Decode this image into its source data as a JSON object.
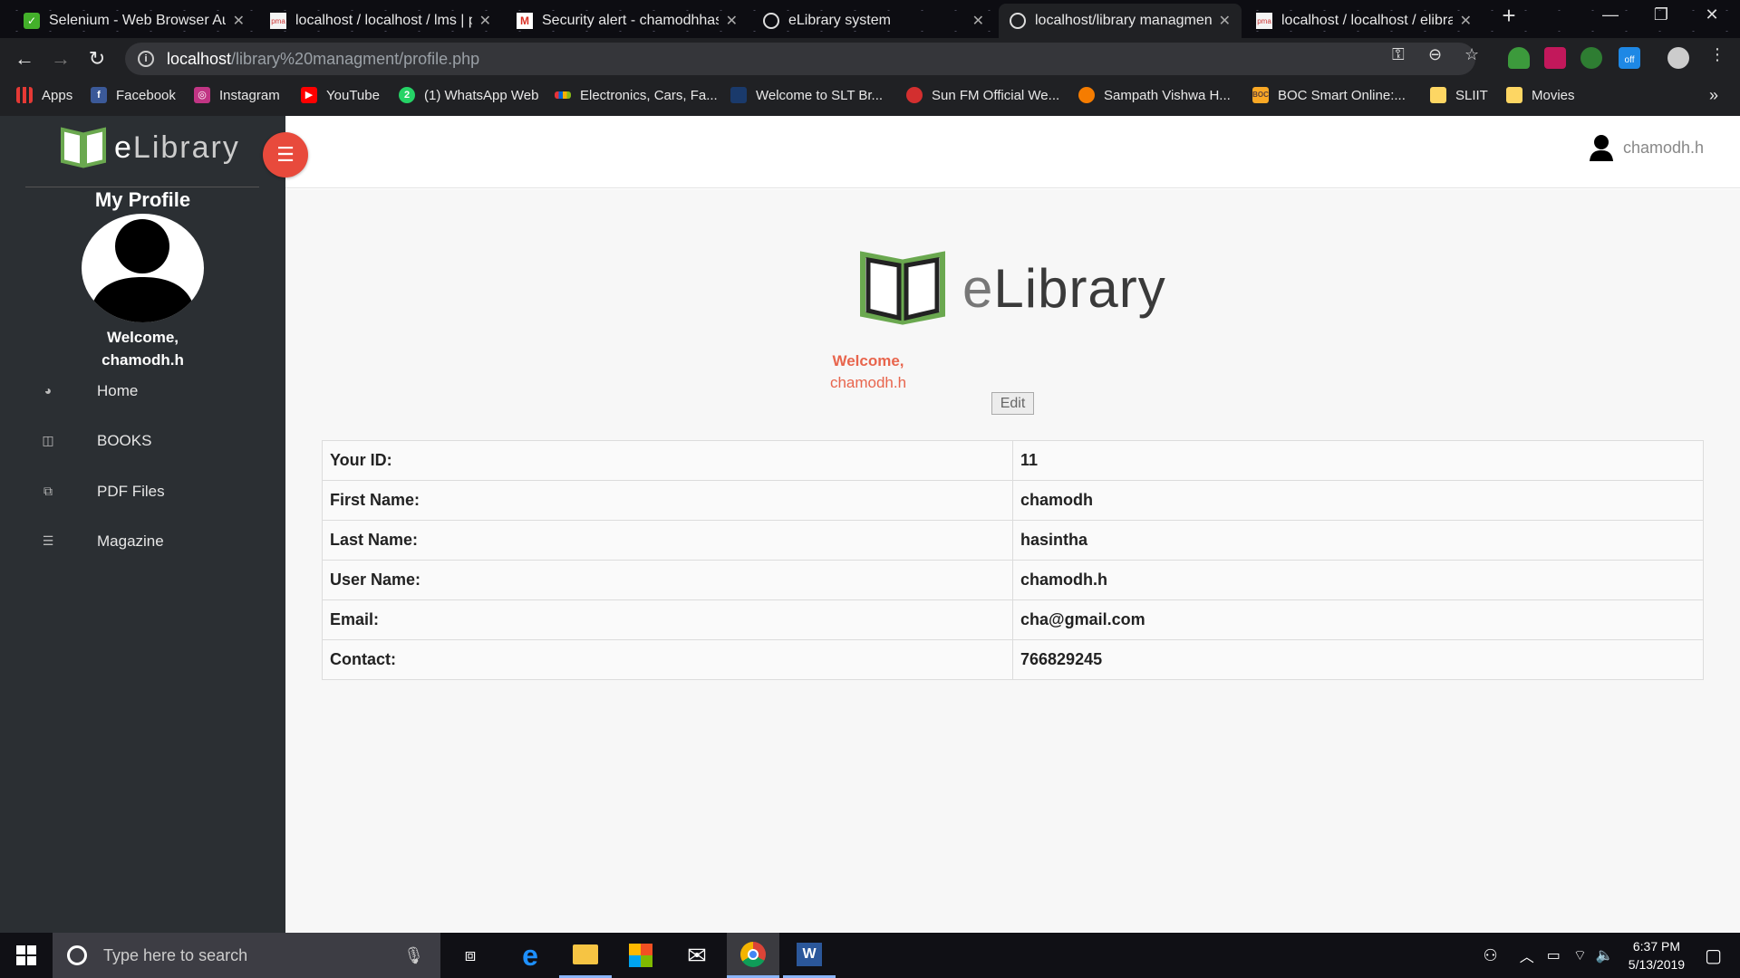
{
  "browser": {
    "tabs": [
      {
        "title": "Selenium - Web Browser Aut",
        "icon": "selenium-icon"
      },
      {
        "title": "localhost / localhost / lms | p",
        "icon": "phpmyadmin-icon"
      },
      {
        "title": "Security alert - chamodhhasi",
        "icon": "gmail-icon"
      },
      {
        "title": "eLibrary system",
        "icon": "globe-icon"
      },
      {
        "title": "localhost/library managment",
        "icon": "globe-icon"
      },
      {
        "title": "localhost / localhost / elibrar",
        "icon": "phpmyadmin-icon"
      }
    ],
    "url_host": "localhost",
    "url_path": "/library%20managment/profile.php",
    "bookmarks": [
      {
        "label": "Apps"
      },
      {
        "label": "Facebook"
      },
      {
        "label": "Instagram"
      },
      {
        "label": "YouTube"
      },
      {
        "label": "(1) WhatsApp Web"
      },
      {
        "label": "Electronics, Cars, Fa..."
      },
      {
        "label": "Welcome to SLT Br..."
      },
      {
        "label": "Sun FM Official We..."
      },
      {
        "label": "Sampath Vishwa H..."
      },
      {
        "label": "BOC Smart Online:..."
      },
      {
        "label": "SLIIT"
      },
      {
        "label": "Movies"
      }
    ],
    "more_bookmarks": "»",
    "extension_badge": "off"
  },
  "sidebar": {
    "logo_e": "e",
    "logo_rest": "Library",
    "title": "My Profile",
    "welcome_line1": "Welcome,",
    "welcome_line2": "chamodh.h",
    "items": [
      {
        "label": "Home",
        "icon": "dashboard-icon"
      },
      {
        "label": "BOOKS",
        "icon": "book-icon"
      },
      {
        "label": "PDF Files",
        "icon": "files-icon"
      },
      {
        "label": "Magazine",
        "icon": "magazine-icon"
      }
    ]
  },
  "header": {
    "username": "chamodh.h"
  },
  "main": {
    "logo_e": "e",
    "logo_rest": "Library",
    "welcome_line1": "Welcome,",
    "welcome_line2": "chamodh.h",
    "edit_label": "Edit",
    "rows": [
      {
        "key": "Your ID:",
        "value": "11"
      },
      {
        "key": "First Name:",
        "value": "chamodh"
      },
      {
        "key": "Last Name:",
        "value": "hasintha"
      },
      {
        "key": "User Name:",
        "value": "chamodh.h"
      },
      {
        "key": "Email:",
        "value": "cha@gmail.com"
      },
      {
        "key": "Contact:",
        "value": "766829245"
      }
    ]
  },
  "taskbar": {
    "search_placeholder": "Type here to search",
    "time": "6:37 PM",
    "date": "5/13/2019"
  },
  "colors": {
    "sidebar_bg": "#2b2f33",
    "accent_red": "#e84a3c",
    "welcome_text": "#e8654d",
    "logo_green": "#6aa84f"
  }
}
